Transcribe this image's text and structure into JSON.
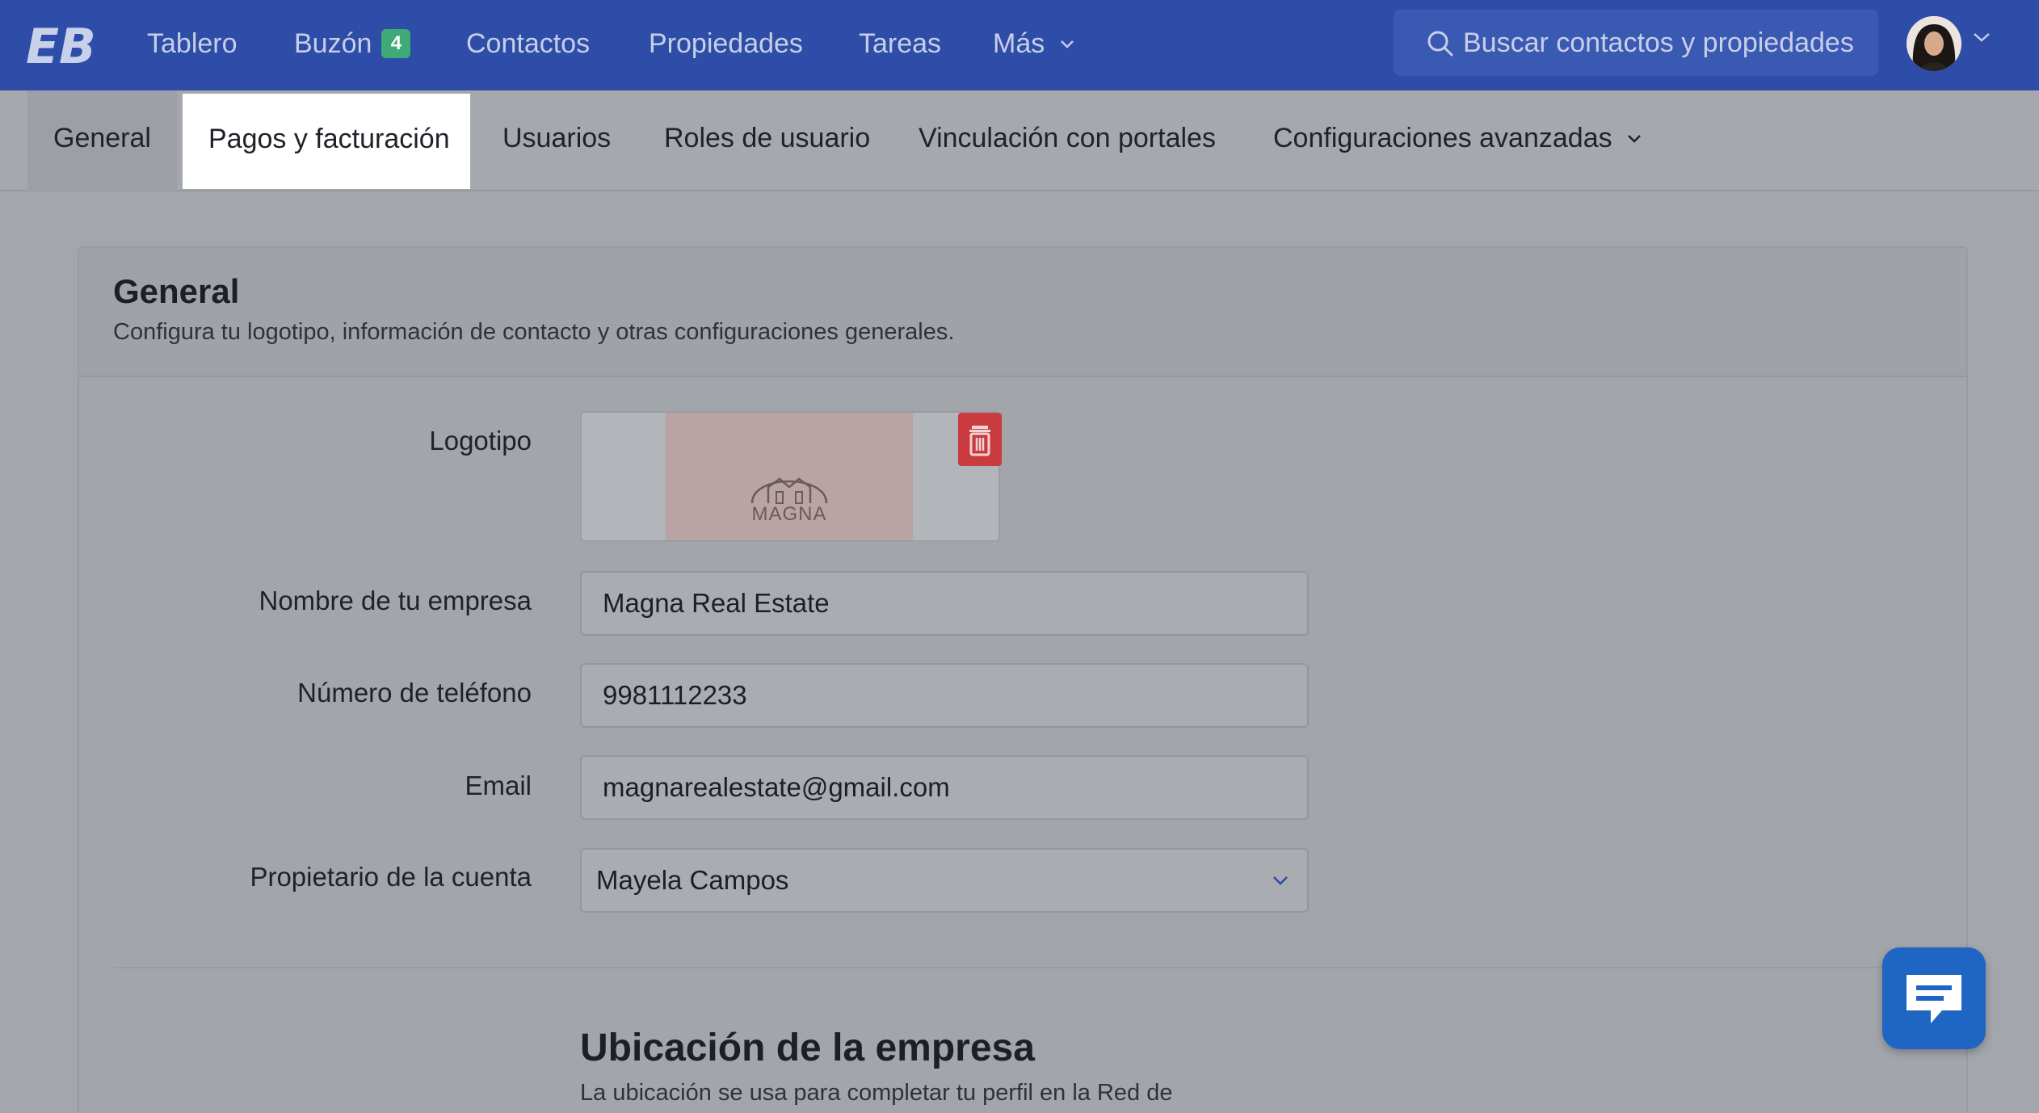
{
  "topnav": {
    "items": [
      {
        "label": "Tablero"
      },
      {
        "label": "Buzón",
        "badge": "4"
      },
      {
        "label": "Contactos"
      },
      {
        "label": "Propiedades"
      },
      {
        "label": "Tareas"
      },
      {
        "label": "Más"
      }
    ],
    "search_placeholder": "Buscar contactos y propiedades"
  },
  "subnav": {
    "items": [
      {
        "label": "General"
      },
      {
        "label": "Pagos y facturación",
        "active": true
      },
      {
        "label": "Usuarios"
      },
      {
        "label": "Roles de usuario"
      },
      {
        "label": "Vinculación con portales"
      },
      {
        "label": "Configuraciones avanzadas"
      }
    ]
  },
  "section": {
    "title": "General",
    "subtitle": "Configura tu logotipo, información de contacto y otras configuraciones generales."
  },
  "form": {
    "logo_label": "Logotipo",
    "logo_brand": "MAGNA",
    "company_label": "Nombre de tu empresa",
    "company_value": "Magna Real Estate",
    "phone_label": "Número de teléfono",
    "phone_value": "9981112233",
    "email_label": "Email",
    "email_value": "magnarealestate@gmail.com",
    "owner_label": "Propietario de la cuenta",
    "owner_value": "Mayela Campos"
  },
  "location": {
    "title": "Ubicación de la empresa",
    "subtitle": "La ubicación se usa para completar tu perfil en la Red de"
  },
  "colors": {
    "nav_bg": "#2e4da8",
    "badge": "#3faa78",
    "delete": "#c93b3e",
    "chat": "#1f65c4"
  },
  "icons": [
    "search-icon",
    "chevron-down-icon",
    "trash-icon",
    "chat-icon",
    "house-logo-icon"
  ]
}
